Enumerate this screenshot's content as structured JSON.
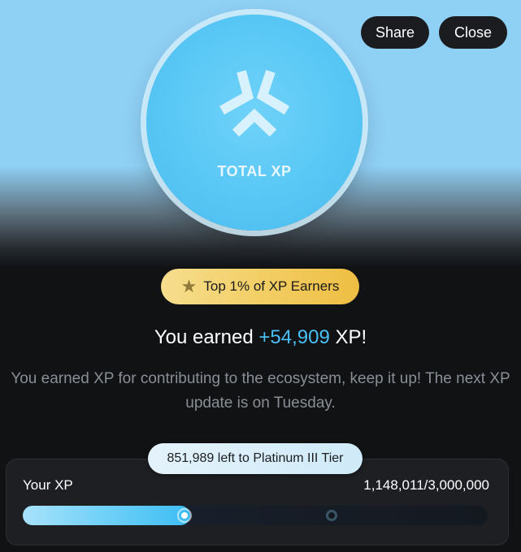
{
  "header": {
    "share_label": "Share",
    "close_label": "Close"
  },
  "coin": {
    "label": "TOTAL XP",
    "logo_icon": "xp-logo-icon"
  },
  "badge": {
    "icon": "star-icon",
    "label": "Top 1% of XP Earners"
  },
  "earned": {
    "prefix": "You earned ",
    "amount": "+54,909",
    "suffix": " XP!"
  },
  "description": "You earned XP for contributing to the ecosystem, keep it up! The next XP update is on Tuesday.",
  "xp": {
    "tier_remaining": "851,989 left to Platinum III Tier",
    "label": "Your XP",
    "value_text": "1,148,011/3,000,000",
    "progress_fraction": 0.36,
    "next_marker_fraction": 0.665
  },
  "colors": {
    "accent": "#49c0f6",
    "badge_gold": "#f2cd62",
    "background": "#111214"
  }
}
